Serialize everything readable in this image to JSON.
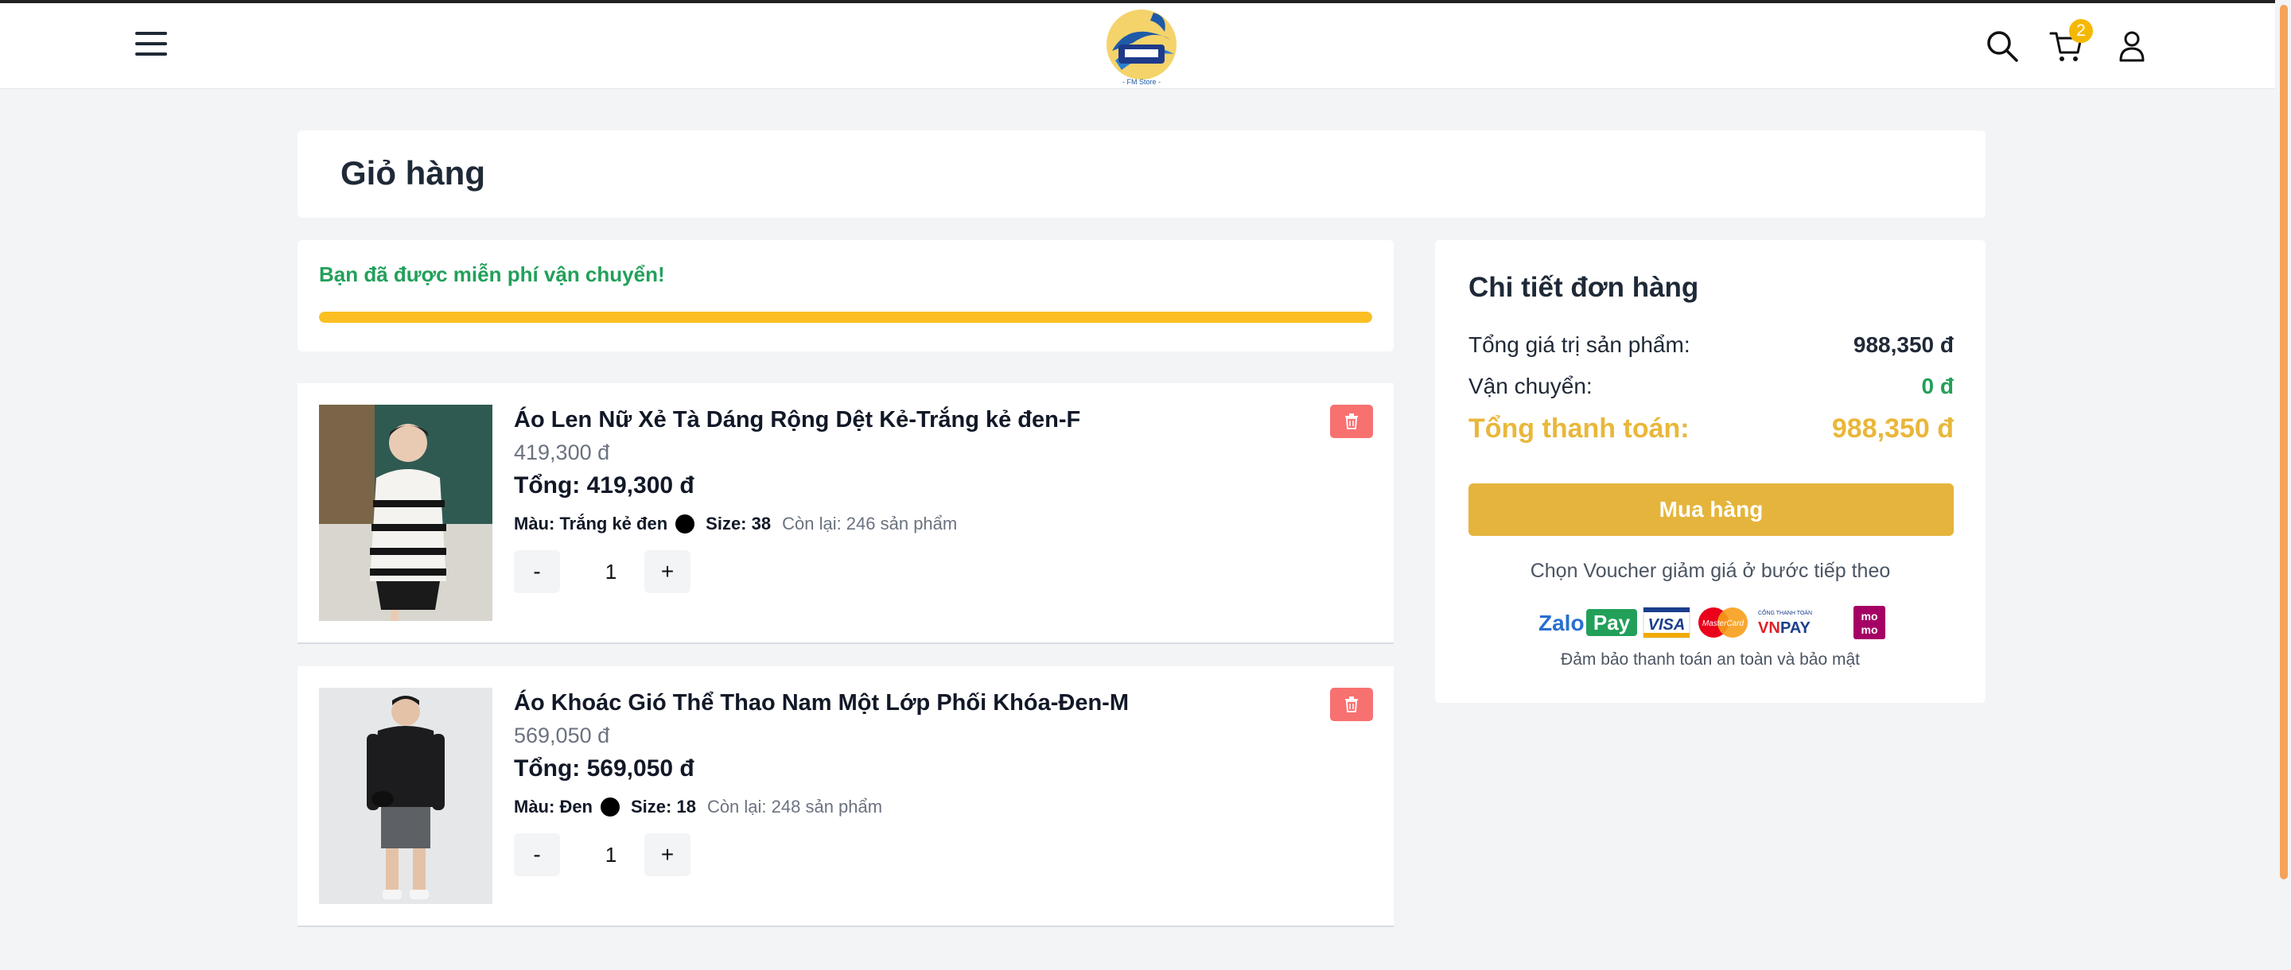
{
  "header": {
    "cart_count": "2",
    "logo_name": "FM Store"
  },
  "page_title": "Giỏ hàng",
  "shipping": {
    "message": "Bạn đã được miễn phí vận chuyển!",
    "progress_percent": 100
  },
  "items": [
    {
      "name": "Áo Len Nữ Xẻ Tà Dáng Rộng Dệt Kẻ-Trắng kẻ đen-F",
      "price": "419,300 đ",
      "total": "Tổng: 419,300 đ",
      "color_label": "Màu: Trắng kẻ đen",
      "color_hex": "#000000",
      "size_label": "Size: 38",
      "stock": "Còn lại: 246 sản phẩm",
      "qty_minus": "-",
      "quantity": "1",
      "qty_plus": "+"
    },
    {
      "name": "Áo Khoác Gió Thể Thao Nam Một Lớp Phối Khóa-Đen-M",
      "price": "569,050 đ",
      "total": "Tổng: 569,050 đ",
      "color_label": "Màu: Đen",
      "color_hex": "#000000",
      "size_label": "Size: 18",
      "stock": "Còn lại: 248 sản phẩm",
      "qty_minus": "-",
      "quantity": "1",
      "qty_plus": "+"
    }
  ],
  "summary": {
    "title": "Chi tiết đơn hàng",
    "subtotal_label": "Tổng giá trị sản phẩm:",
    "subtotal_value": "988,350 đ",
    "shipping_label": "Vận chuyển:",
    "shipping_value": "0 đ",
    "grand_label": "Tổng thanh toán:",
    "grand_value": "988,350 đ",
    "buy_button": "Mua hàng",
    "voucher_note": "Chọn Voucher giảm giá ở bước tiếp theo",
    "payment_methods": [
      "ZaloPay",
      "VISA",
      "MasterCard",
      "VNPAY",
      "MoMo"
    ],
    "safe_note": "Đảm bảo thanh toán an toàn và bảo mật"
  },
  "colors": {
    "accent_yellow": "#e4b43c",
    "success_green": "#22a05a",
    "delete_red": "#f87171"
  }
}
